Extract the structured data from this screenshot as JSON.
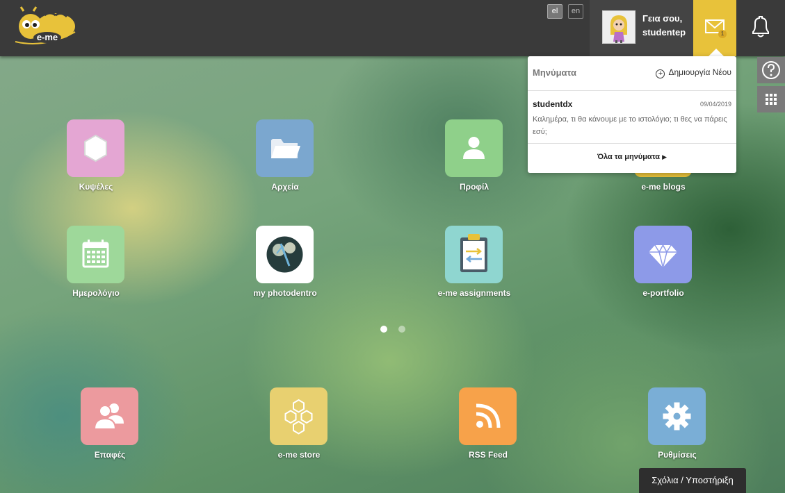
{
  "header": {
    "logo_text": "e-me",
    "lang_el": "el",
    "lang_en": "en",
    "greeting_line1": "Γεια σου,",
    "greeting_line2": "studentep",
    "mail_badge": "1"
  },
  "messages_popup": {
    "title": "Μηνύματα",
    "new_label": "Δημιουργία Νέου",
    "message": {
      "sender": "studentdx",
      "date": "09/04/2019",
      "text": "Καλημέρα, τι θα κάνουμε με το ιστολόγιο; τι θες να πάρεις εσύ;"
    },
    "all_label": "Όλα τα μηνύματα"
  },
  "apps": [
    {
      "label": "Κυψέλες",
      "color": "#e4a6d3",
      "icon": "hexagon-icon"
    },
    {
      "label": "Αρχεία",
      "color": "#7ba7cf",
      "icon": "folder-icon"
    },
    {
      "label": "Προφίλ",
      "color": "#8fd08a",
      "icon": "user-icon"
    },
    {
      "label": "e-me blogs",
      "color": "#e8c23a",
      "icon": "blog-icon"
    },
    {
      "label": "Ημερολόγιο",
      "color": "#9ed89a",
      "icon": "calendar-icon"
    },
    {
      "label": "my photodentro",
      "color": "#ffffff",
      "icon": "photodentro-icon"
    },
    {
      "label": "e-me assignments",
      "color": "#8fd6d0",
      "icon": "clipboard-icon"
    },
    {
      "label": "e-portfolio",
      "color": "#8d9ae8",
      "icon": "diamond-icon"
    }
  ],
  "dock": [
    {
      "label": "Επαφές",
      "color": "#ec9a9e",
      "icon": "contacts-icon"
    },
    {
      "label": "e-me store",
      "color": "#e8d070",
      "icon": "honeycomb-icon"
    },
    {
      "label": "RSS Feed",
      "color": "#f7a24a",
      "icon": "rss-icon"
    },
    {
      "label": "Ρυθμίσεις",
      "color": "#7aaed6",
      "icon": "gear-icon"
    }
  ],
  "feedback_label": "Σχόλια / Υποστήριξη"
}
